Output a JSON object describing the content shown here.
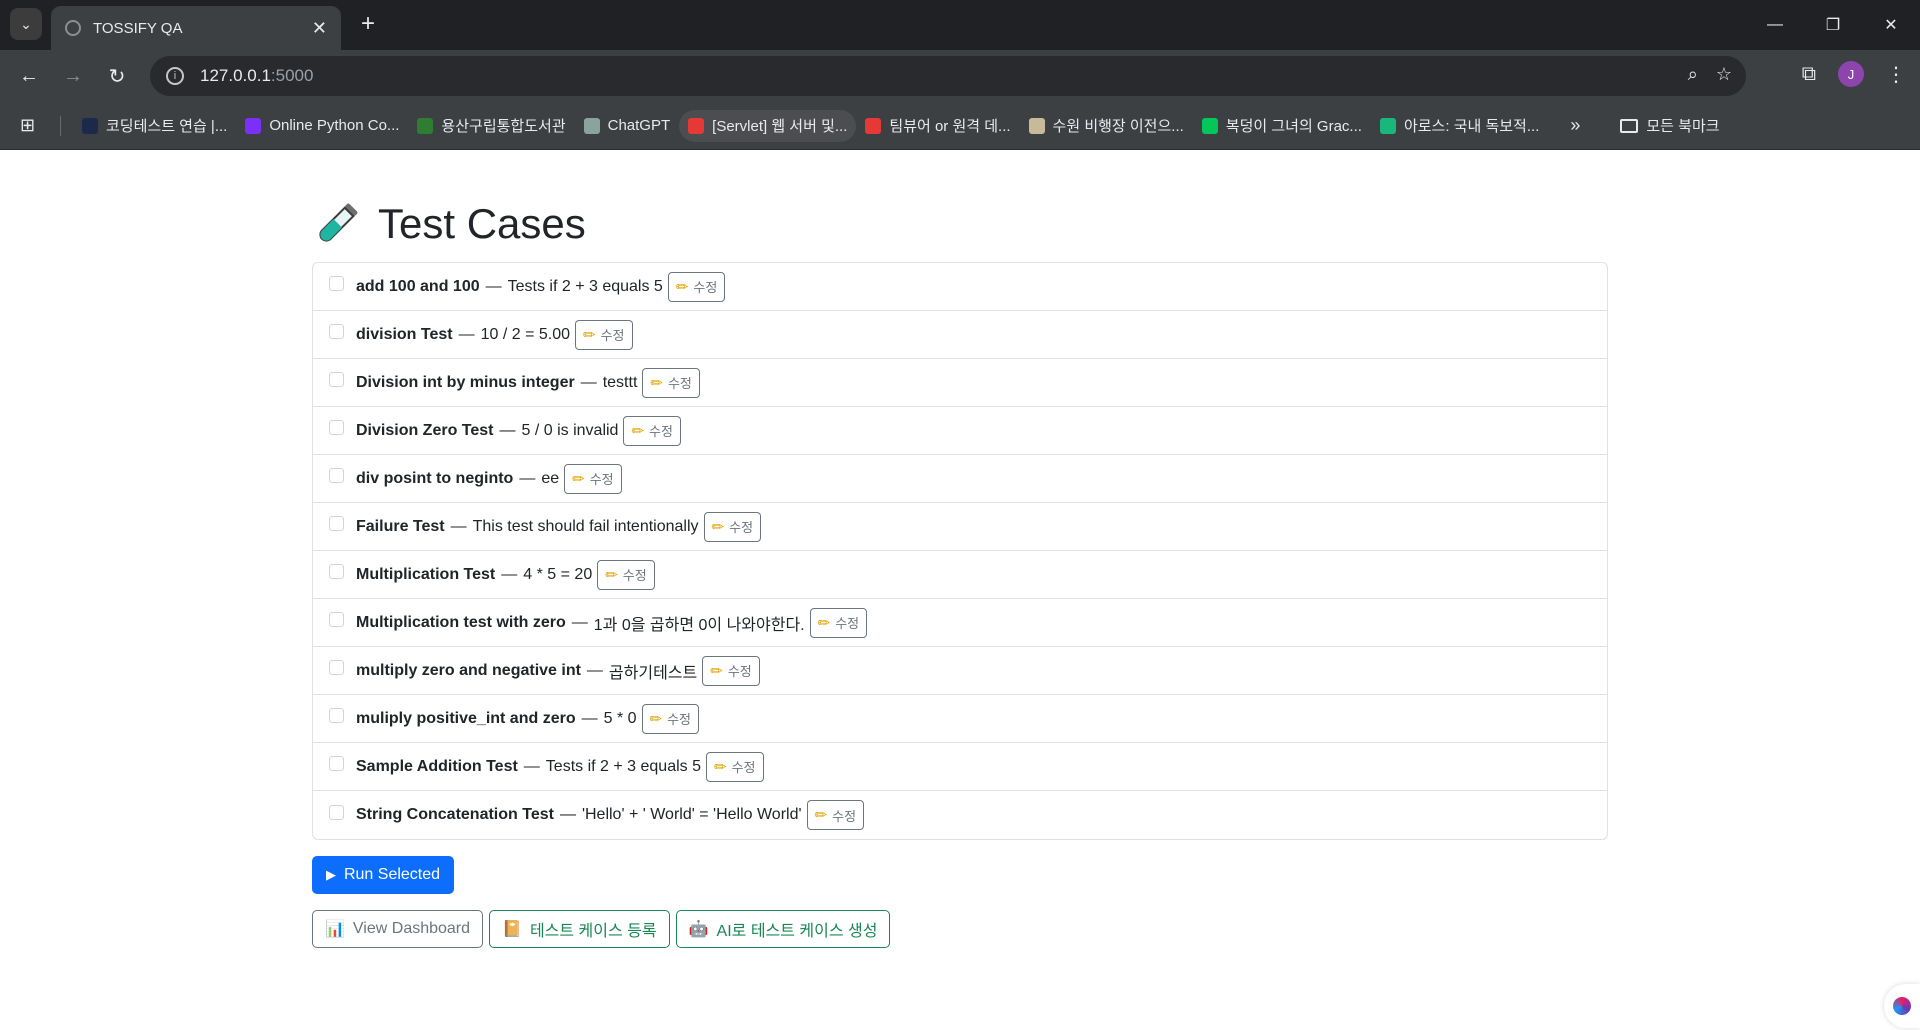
{
  "browser": {
    "tab_title": "TOSSIFY QA",
    "url_host": "127.0.0.1",
    "url_port": ":5000",
    "avatar_letter": "J",
    "bookmarks": [
      {
        "label": "코딩테스트 연습 |...",
        "color": "#1b2a4a"
      },
      {
        "label": "Online Python Co...",
        "color": "#7b2ff7"
      },
      {
        "label": "용산구립통합도서관",
        "color": "#2e7d32"
      },
      {
        "label": "ChatGPT",
        "color": "#8aa39b"
      },
      {
        "label": "[Servlet] 웹 서버 및...",
        "color": "#e53935"
      },
      {
        "label": "팀뷰어 or 원격 데...",
        "color": "#e53935"
      },
      {
        "label": "수원 비행장 이전으...",
        "color": "#c8b99a"
      },
      {
        "label": "복덩이 그녀의 Grac...",
        "color": "#03c75a"
      },
      {
        "label": "아로스: 국내 독보적...",
        "color": "#19b77c"
      }
    ],
    "all_bookmarks": "모든 북마크"
  },
  "page": {
    "title": "Test Cases",
    "edit_label": "수정",
    "test_cases": [
      {
        "name": "add 100 and 100",
        "desc": "Tests if 2 + 3 equals 5"
      },
      {
        "name": "division Test",
        "desc": "10 / 2 = 5.00"
      },
      {
        "name": "Division int by minus integer",
        "desc": "testtt"
      },
      {
        "name": "Division Zero Test",
        "desc": "5 / 0 is invalid"
      },
      {
        "name": "div posint to neginto",
        "desc": "ee"
      },
      {
        "name": "Failure Test",
        "desc": "This test should fail intentionally"
      },
      {
        "name": "Multiplication Test",
        "desc": "4 * 5 = 20"
      },
      {
        "name": "Multiplication test with zero",
        "desc": "1과 0을 곱하면 0이 나와야한다."
      },
      {
        "name": "multiply zero and negative int",
        "desc": "곱하기테스트"
      },
      {
        "name": "muliply positive_int and zero",
        "desc": "5 * 0"
      },
      {
        "name": "Sample Addition Test",
        "desc": "Tests if 2 + 3 equals 5"
      },
      {
        "name": "String Concatenation Test",
        "desc": "'Hello' + ' World' = 'Hello World'"
      }
    ],
    "run_button": "Run Selected",
    "dashboard_button": "View Dashboard",
    "register_button": "테스트 케이스 등록",
    "ai_button": "AI로 테스트 케이스 생성"
  }
}
